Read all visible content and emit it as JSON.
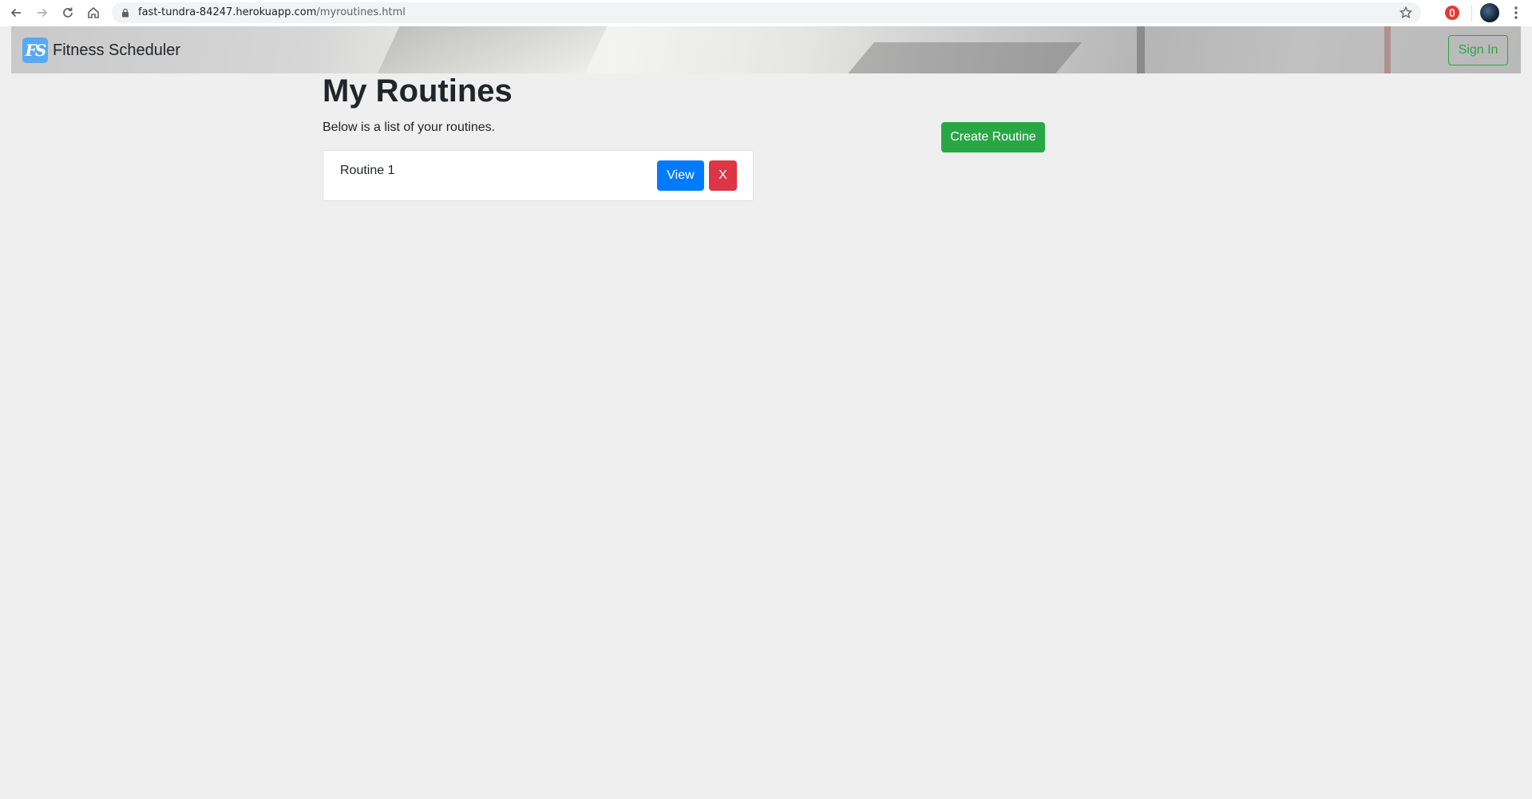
{
  "browser": {
    "url_host": "fast-tundra-84247.herokuapp.com",
    "url_path": "/myroutines.html"
  },
  "navbar": {
    "brand_logo": "FS",
    "brand_name": "Fitness Scheduler",
    "sign_in_label": "Sign In"
  },
  "main": {
    "title": "My Routines",
    "subtitle": "Below is a list of your routines.",
    "create_label": "Create Routine",
    "routines": [
      {
        "name": "Routine 1",
        "view_label": "View",
        "delete_label": "X"
      }
    ]
  },
  "colors": {
    "success": "#28a745",
    "primary": "#007bff",
    "danger": "#dc3545",
    "background": "#efefef"
  }
}
